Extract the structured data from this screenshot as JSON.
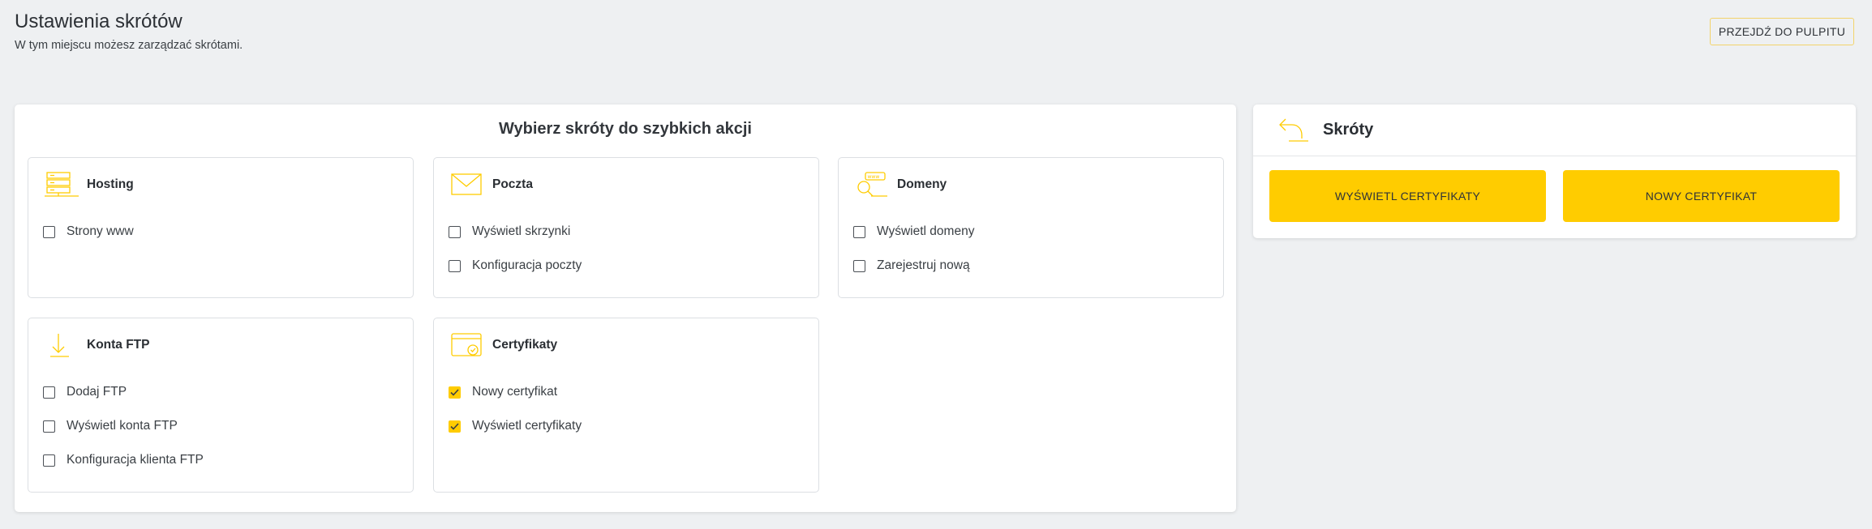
{
  "header": {
    "title": "Ustawienia skrótów",
    "subtitle": "W tym miejscu możesz zarządzać skrótami.",
    "dashboard_button": "PRZEJDŹ DO PULPITU"
  },
  "left_panel": {
    "title": "Wybierz skróty do szybkich akcji",
    "cards": [
      {
        "title": "Hosting",
        "icon": "server-icon",
        "options": [
          {
            "label": "Strony www",
            "checked": false
          }
        ]
      },
      {
        "title": "Poczta",
        "icon": "envelope-icon",
        "options": [
          {
            "label": "Wyświetl skrzynki",
            "checked": false
          },
          {
            "label": "Konfiguracja poczty",
            "checked": false
          }
        ]
      },
      {
        "title": "Domeny",
        "icon": "www-search-icon",
        "options": [
          {
            "label": "Wyświetl domeny",
            "checked": false
          },
          {
            "label": "Zarejestruj nową",
            "checked": false
          }
        ]
      },
      {
        "title": "Konta FTP",
        "icon": "download-arrow-icon",
        "options": [
          {
            "label": "Dodaj FTP",
            "checked": false
          },
          {
            "label": "Wyświetl konta FTP",
            "checked": false
          },
          {
            "label": "Konfiguracja klienta FTP",
            "checked": false
          }
        ]
      },
      {
        "title": "Certyfikaty",
        "icon": "certificate-icon",
        "options": [
          {
            "label": "Nowy certyfikat",
            "checked": true
          },
          {
            "label": "Wyświetl certyfikaty",
            "checked": true
          }
        ]
      }
    ]
  },
  "right_panel": {
    "title": "Skróty",
    "icon": "share-arrow-icon",
    "buttons": [
      "WYŚWIETL CERTYFIKATY",
      "NOWY CERTYFIKAT"
    ]
  },
  "colors": {
    "accent": "#ffcc00",
    "background": "#eef0f2",
    "panel": "#ffffff",
    "border": "#dcdfe3"
  }
}
